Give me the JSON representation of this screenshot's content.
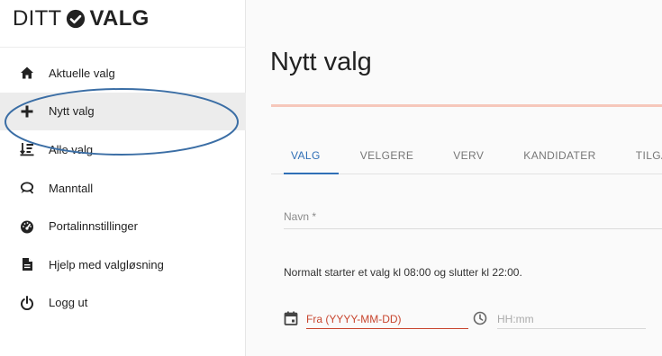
{
  "logo": {
    "left": "DITT",
    "right": "VALG"
  },
  "sidebar": {
    "items": [
      {
        "label": "Aktuelle valg",
        "icon": "home-icon"
      },
      {
        "label": "Nytt valg",
        "icon": "plus-icon"
      },
      {
        "label": "Alle valg",
        "icon": "sort-list-icon"
      },
      {
        "label": "Manntall",
        "icon": "chat-search-icon"
      },
      {
        "label": "Portalinnstillinger",
        "icon": "gauge-icon"
      },
      {
        "label": "Hjelp med valgløsning",
        "icon": "file-icon"
      },
      {
        "label": "Logg ut",
        "icon": "power-icon"
      }
    ],
    "active_index": 1
  },
  "main": {
    "title": "Nytt valg",
    "tabs": [
      {
        "label": "VALG"
      },
      {
        "label": "VELGERE"
      },
      {
        "label": "VERV"
      },
      {
        "label": "KANDIDATER"
      },
      {
        "label": "TILGANG"
      }
    ],
    "active_tab": 0,
    "name_field": {
      "label": "Navn *"
    },
    "info_text": "Normalt starter et valg kl 08:00 og slutter kl 22:00.",
    "date_field": {
      "placeholder": "Fra (YYYY-MM-DD)"
    },
    "time_field": {
      "placeholder": "HH:mm"
    }
  },
  "colors": {
    "accent_tab": "#2f6fb6",
    "divider": "#f6c7bb",
    "error_red": "#c8462f",
    "annotation_ellipse": "#3b6ea5"
  }
}
